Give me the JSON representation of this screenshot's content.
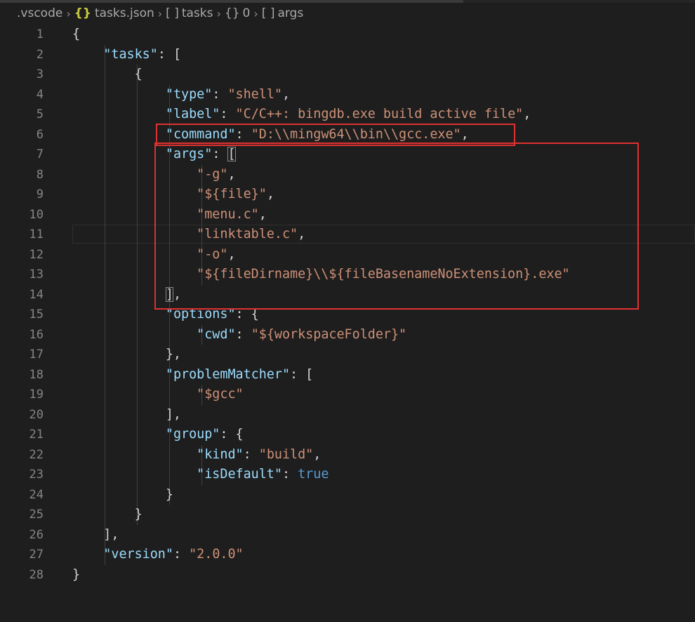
{
  "breadcrumb": [
    {
      "label": ".vscode",
      "icon": ""
    },
    {
      "label": "tasks.json",
      "icon": "{}"
    },
    {
      "label": "tasks",
      "icon": "[ ]"
    },
    {
      "label": "0",
      "icon": "{}"
    },
    {
      "label": "args",
      "icon": "[ ]"
    }
  ],
  "colors": {
    "background": "#1e1e1e",
    "key": "#9cdcfe",
    "string": "#ce9178",
    "boolean": "#569cd6",
    "punctuation": "#d4d4d4",
    "line_number": "#858585",
    "annotation": "#e03131"
  },
  "lines": [
    {
      "n": "1",
      "tokens": [
        {
          "t": "{",
          "c": "p"
        }
      ]
    },
    {
      "n": "2",
      "tokens": [
        {
          "t": "    ",
          "c": "p"
        },
        {
          "t": "\"tasks\"",
          "c": "k"
        },
        {
          "t": ": [",
          "c": "p"
        }
      ]
    },
    {
      "n": "3",
      "tokens": [
        {
          "t": "        {",
          "c": "p"
        }
      ]
    },
    {
      "n": "4",
      "tokens": [
        {
          "t": "            ",
          "c": "p"
        },
        {
          "t": "\"type\"",
          "c": "k"
        },
        {
          "t": ": ",
          "c": "p"
        },
        {
          "t": "\"shell\"",
          "c": "s"
        },
        {
          "t": ",",
          "c": "p"
        }
      ]
    },
    {
      "n": "5",
      "tokens": [
        {
          "t": "            ",
          "c": "p"
        },
        {
          "t": "\"label\"",
          "c": "k"
        },
        {
          "t": ": ",
          "c": "p"
        },
        {
          "t": "\"C/C++: bingdb.exe build active file\"",
          "c": "s"
        },
        {
          "t": ",",
          "c": "p"
        }
      ]
    },
    {
      "n": "6",
      "tokens": [
        {
          "t": "            ",
          "c": "p"
        },
        {
          "t": "\"command\"",
          "c": "k"
        },
        {
          "t": ": ",
          "c": "p"
        },
        {
          "t": "\"D:\\\\mingw64\\\\bin\\\\gcc.exe\"",
          "c": "s"
        },
        {
          "t": ",",
          "c": "p"
        }
      ]
    },
    {
      "n": "7",
      "tokens": [
        {
          "t": "            ",
          "c": "p"
        },
        {
          "t": "\"args\"",
          "c": "k"
        },
        {
          "t": ": ",
          "c": "p"
        },
        {
          "t": "[",
          "c": "p",
          "m": true
        }
      ]
    },
    {
      "n": "8",
      "tokens": [
        {
          "t": "                ",
          "c": "p"
        },
        {
          "t": "\"-g\"",
          "c": "s"
        },
        {
          "t": ",",
          "c": "p"
        }
      ]
    },
    {
      "n": "9",
      "tokens": [
        {
          "t": "                ",
          "c": "p"
        },
        {
          "t": "\"${file}\"",
          "c": "s"
        },
        {
          "t": ",",
          "c": "p"
        }
      ]
    },
    {
      "n": "10",
      "tokens": [
        {
          "t": "                ",
          "c": "p"
        },
        {
          "t": "\"menu.c\"",
          "c": "s"
        },
        {
          "t": ",",
          "c": "p"
        }
      ]
    },
    {
      "n": "11",
      "tokens": [
        {
          "t": "                ",
          "c": "p"
        },
        {
          "t": "\"linktable.c\"",
          "c": "s"
        },
        {
          "t": ",",
          "c": "p"
        }
      ]
    },
    {
      "n": "12",
      "tokens": [
        {
          "t": "                ",
          "c": "p"
        },
        {
          "t": "\"-o\"",
          "c": "s"
        },
        {
          "t": ",",
          "c": "p"
        }
      ]
    },
    {
      "n": "13",
      "tokens": [
        {
          "t": "                ",
          "c": "p"
        },
        {
          "t": "\"${fileDirname}\\\\${fileBasenameNoExtension}.exe\"",
          "c": "s"
        }
      ]
    },
    {
      "n": "14",
      "tokens": [
        {
          "t": "            ",
          "c": "p"
        },
        {
          "t": "]",
          "c": "p",
          "m": true
        },
        {
          "t": ",",
          "c": "p"
        }
      ]
    },
    {
      "n": "15",
      "tokens": [
        {
          "t": "            ",
          "c": "p"
        },
        {
          "t": "\"options\"",
          "c": "k"
        },
        {
          "t": ": {",
          "c": "p"
        }
      ]
    },
    {
      "n": "16",
      "tokens": [
        {
          "t": "                ",
          "c": "p"
        },
        {
          "t": "\"cwd\"",
          "c": "k"
        },
        {
          "t": ": ",
          "c": "p"
        },
        {
          "t": "\"${workspaceFolder}\"",
          "c": "s"
        }
      ]
    },
    {
      "n": "17",
      "tokens": [
        {
          "t": "            },",
          "c": "p"
        }
      ]
    },
    {
      "n": "18",
      "tokens": [
        {
          "t": "            ",
          "c": "p"
        },
        {
          "t": "\"problemMatcher\"",
          "c": "k"
        },
        {
          "t": ": [",
          "c": "p"
        }
      ]
    },
    {
      "n": "19",
      "tokens": [
        {
          "t": "                ",
          "c": "p"
        },
        {
          "t": "\"$gcc\"",
          "c": "s"
        }
      ]
    },
    {
      "n": "20",
      "tokens": [
        {
          "t": "            ],",
          "c": "p"
        }
      ]
    },
    {
      "n": "21",
      "tokens": [
        {
          "t": "            ",
          "c": "p"
        },
        {
          "t": "\"group\"",
          "c": "k"
        },
        {
          "t": ": {",
          "c": "p"
        }
      ]
    },
    {
      "n": "22",
      "tokens": [
        {
          "t": "                ",
          "c": "p"
        },
        {
          "t": "\"kind\"",
          "c": "k"
        },
        {
          "t": ": ",
          "c": "p"
        },
        {
          "t": "\"build\"",
          "c": "s"
        },
        {
          "t": ",",
          "c": "p"
        }
      ]
    },
    {
      "n": "23",
      "tokens": [
        {
          "t": "                ",
          "c": "p"
        },
        {
          "t": "\"isDefault\"",
          "c": "k"
        },
        {
          "t": ": ",
          "c": "p"
        },
        {
          "t": "true",
          "c": "b"
        }
      ]
    },
    {
      "n": "24",
      "tokens": [
        {
          "t": "            }",
          "c": "p"
        }
      ]
    },
    {
      "n": "25",
      "tokens": [
        {
          "t": "        }",
          "c": "p"
        }
      ]
    },
    {
      "n": "26",
      "tokens": [
        {
          "t": "    ],",
          "c": "p"
        }
      ]
    },
    {
      "n": "27",
      "tokens": [
        {
          "t": "    ",
          "c": "p"
        },
        {
          "t": "\"version\"",
          "c": "k"
        },
        {
          "t": ": ",
          "c": "p"
        },
        {
          "t": "\"2.0.0\"",
          "c": "s"
        }
      ]
    },
    {
      "n": "28",
      "tokens": [
        {
          "t": "}",
          "c": "p"
        }
      ]
    }
  ]
}
